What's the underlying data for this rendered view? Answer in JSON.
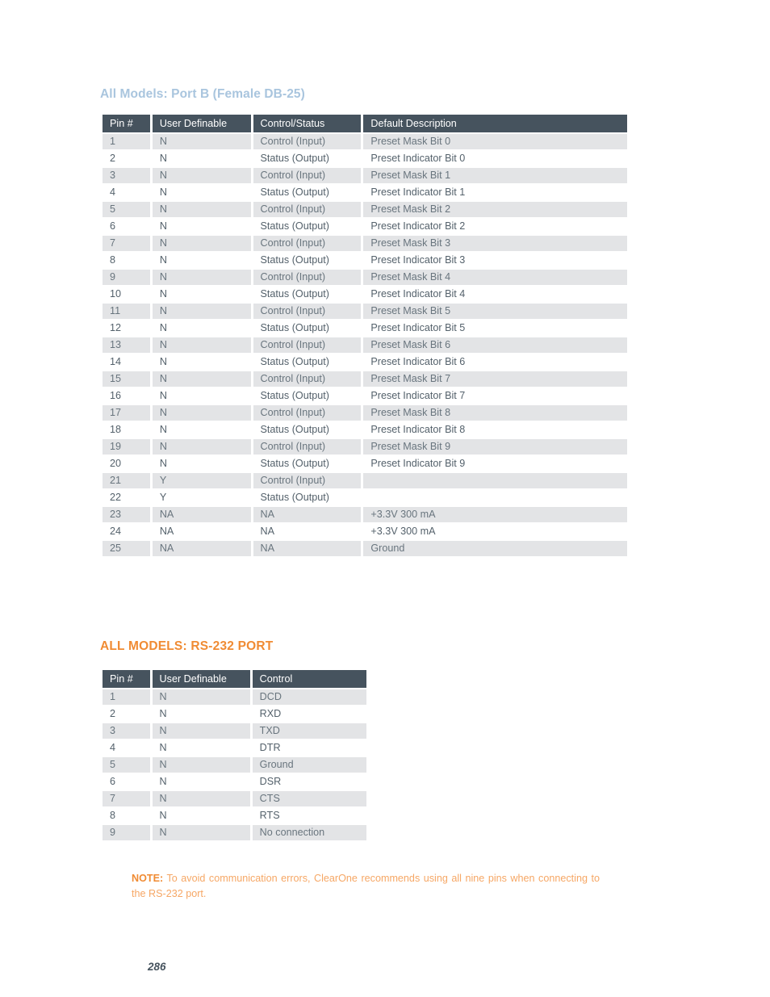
{
  "document": {
    "page_number": "286"
  },
  "sections": [
    {
      "heading": "All Models: Port B (Female DB-25)",
      "heading_color": "#a9c5de",
      "table": {
        "columns": [
          "Pin #",
          "User Definable",
          "Control/Status",
          "Default Description"
        ],
        "rows": [
          [
            "1",
            "N",
            "Control (Input)",
            "Preset Mask Bit 0"
          ],
          [
            "2",
            "N",
            "Status (Output)",
            "Preset Indicator Bit 0"
          ],
          [
            "3",
            "N",
            "Control (Input)",
            "Preset Mask Bit 1"
          ],
          [
            "4",
            "N",
            "Status (Output)",
            "Preset Indicator Bit 1"
          ],
          [
            "5",
            "N",
            "Control (Input)",
            "Preset Mask Bit 2"
          ],
          [
            "6",
            "N",
            "Status (Output)",
            "Preset Indicator Bit 2"
          ],
          [
            "7",
            "N",
            "Control (Input)",
            "Preset Mask Bit 3"
          ],
          [
            "8",
            "N",
            "Status (Output)",
            "Preset Indicator Bit 3"
          ],
          [
            "9",
            "N",
            "Control (Input)",
            "Preset Mask Bit 4"
          ],
          [
            "10",
            "N",
            "Status (Output)",
            "Preset Indicator Bit 4"
          ],
          [
            "11",
            "N",
            "Control (Input)",
            "Preset Mask Bit 5"
          ],
          [
            "12",
            "N",
            "Status (Output)",
            "Preset Indicator Bit 5"
          ],
          [
            "13",
            "N",
            "Control (Input)",
            "Preset Mask Bit 6"
          ],
          [
            "14",
            "N",
            "Status (Output)",
            "Preset Indicator Bit 6"
          ],
          [
            "15",
            "N",
            "Control (Input)",
            "Preset Mask Bit 7"
          ],
          [
            "16",
            "N",
            "Status (Output)",
            "Preset Indicator Bit 7"
          ],
          [
            "17",
            "N",
            "Control (Input)",
            "Preset Mask Bit 8"
          ],
          [
            "18",
            "N",
            "Status (Output)",
            "Preset Indicator Bit 8"
          ],
          [
            "19",
            "N",
            "Control (Input)",
            "Preset Mask Bit 9"
          ],
          [
            "20",
            "N",
            "Status (Output)",
            "Preset Indicator Bit 9"
          ],
          [
            "21",
            "Y",
            "Control (Input)",
            ""
          ],
          [
            "22",
            "Y",
            "Status (Output)",
            ""
          ],
          [
            "23",
            "NA",
            "NA",
            "+3.3V 300 mA"
          ],
          [
            "24",
            "NA",
            "NA",
            "+3.3V 300 mA"
          ],
          [
            "25",
            "NA",
            "NA",
            "Ground"
          ]
        ]
      }
    },
    {
      "heading": "ALL MODELS: RS-232 PORT",
      "heading_color": "#f08b33",
      "table": {
        "columns": [
          "Pin #",
          "User Definable",
          "Control"
        ],
        "rows": [
          [
            "1",
            "N",
            "DCD"
          ],
          [
            "2",
            "N",
            "RXD"
          ],
          [
            "3",
            "N",
            "TXD"
          ],
          [
            "4",
            "N",
            "DTR"
          ],
          [
            "5",
            "N",
            "Ground"
          ],
          [
            "6",
            "N",
            "DSR"
          ],
          [
            "7",
            "N",
            "CTS"
          ],
          [
            "8",
            "N",
            "RTS"
          ],
          [
            "9",
            "N",
            "No connection"
          ]
        ]
      }
    }
  ],
  "note": {
    "label": "NOTE",
    "separator": ":",
    "text": "To avoid communication errors, ClearOne recommends using all nine pins when connecting to the RS-232 port."
  }
}
